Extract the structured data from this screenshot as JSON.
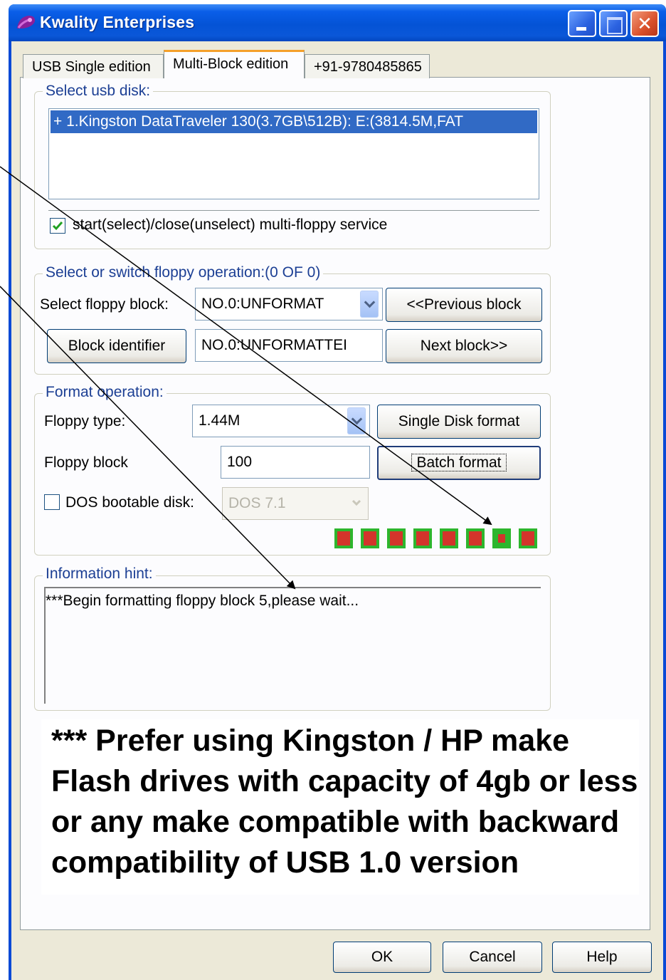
{
  "window": {
    "title": "Kwality Enterprises"
  },
  "tabs": [
    {
      "label": "USB  Single  edition"
    },
    {
      "label": "Multi-Block  edition"
    },
    {
      "label": "+91-9780485865"
    }
  ],
  "usb_group": {
    "legend": "Select usb disk:",
    "disks": [
      "+ 1.Kingston DataTraveler 130(3.7GB\\512B): E:(3814.5M,FAT"
    ],
    "checkbox_label": "start(select)/close(unselect) multi-floppy service",
    "checkbox_checked": true
  },
  "floppy_group": {
    "legend": "Select or switch floppy operation:(0 OF 0)",
    "select_block_label": "Select floppy block:",
    "select_block_value": "NO.0:UNFORMAT",
    "previous_button": "<<Previous block",
    "identifier_button": "Block identifier",
    "identifier_value": "NO.0:UNFORMATTEI",
    "next_button": "Next block>>"
  },
  "format_group": {
    "legend": "Format operation:",
    "floppy_type_label": "Floppy type:",
    "floppy_type_value": "1.44M",
    "single_format_button": "Single Disk format",
    "floppy_block_label": "Floppy block",
    "floppy_block_value": "100",
    "batch_format_button": "Batch format",
    "dos_label": "DOS bootable disk:",
    "dos_checked": false,
    "dos_value": "DOS 7.1",
    "status_lamps": 8
  },
  "info_group": {
    "legend": "Information hint:",
    "text": "***Begin formatting floppy block 5,please wait..."
  },
  "note": {
    "text": "*** Prefer using Kingston / HP make Flash drives with capacity of 4gb or less or any make compatible with backward compatibility of USB 1.0 version"
  },
  "dialog_buttons": {
    "ok": "OK",
    "cancel": "Cancel",
    "help": "Help"
  },
  "colors": {
    "titlebar": "#0453d6",
    "selection": "#316ac5",
    "group_legend": "#1c3f94",
    "lamp_green": "#2db62d",
    "lamp_red": "#d3342b",
    "face": "#ece9d8"
  }
}
